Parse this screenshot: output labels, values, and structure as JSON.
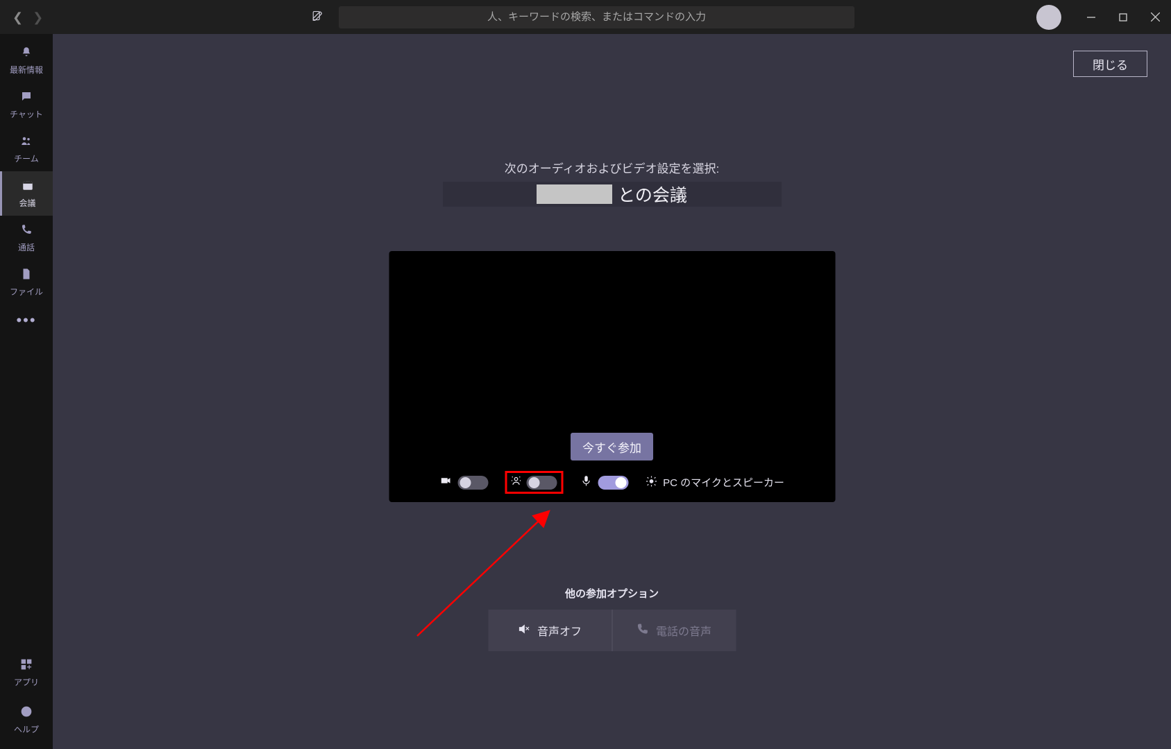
{
  "titlebar": {
    "search_placeholder": "人、キーワードの検索、またはコマンドの入力"
  },
  "rail": {
    "activity": "最新情報",
    "chat": "チャット",
    "teams": "チーム",
    "meetings": "会議",
    "calls": "通話",
    "files": "ファイル",
    "apps": "アプリ",
    "help": "ヘルプ"
  },
  "main": {
    "close": "閉じる",
    "choose_settings": "次のオーディオおよびビデオ設定を選択:",
    "meeting_with_suffix": "との会議",
    "join_now": "今すぐ参加",
    "device_settings": "PC のマイクとスピーカー",
    "other_options_title": "他の参加オプション",
    "audio_off": "音声オフ",
    "phone_audio": "電話の音声"
  }
}
